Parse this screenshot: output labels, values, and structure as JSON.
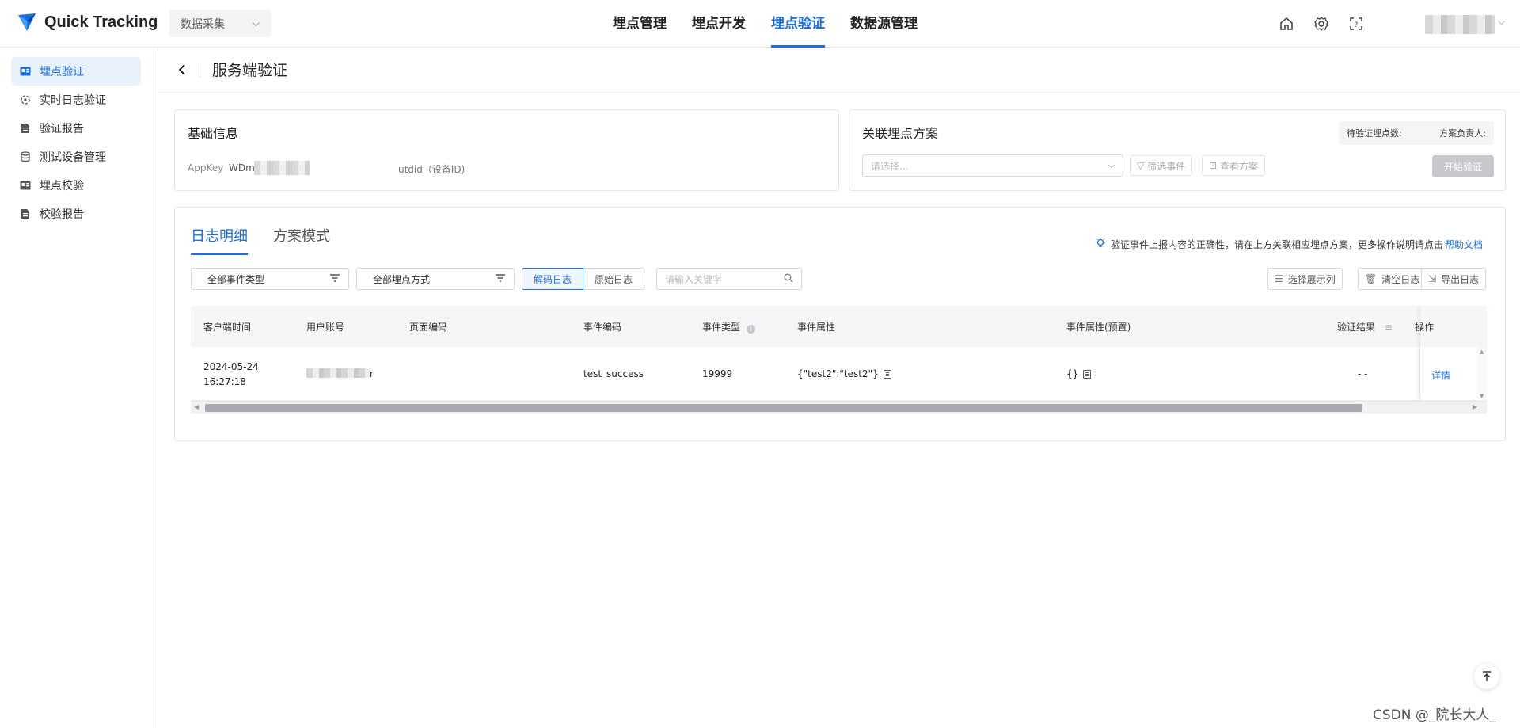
{
  "app": {
    "title": "Quick Tracking",
    "module": "数据采集",
    "brand_color": "#1b6fe0"
  },
  "nav": {
    "items": [
      "埋点管理",
      "埋点开发",
      "埋点验证",
      "数据源管理"
    ],
    "active": "埋点验证"
  },
  "top_icons": [
    "home-icon",
    "gear-icon",
    "scan-icon"
  ],
  "sidebar": {
    "items": [
      {
        "label": "埋点验证",
        "icon": "scan-card-icon",
        "active": true
      },
      {
        "label": "实时日志验证",
        "icon": "realtime-icon",
        "active": false
      },
      {
        "label": "验证报告",
        "icon": "report-icon",
        "active": false
      },
      {
        "label": "测试设备管理",
        "icon": "database-icon",
        "active": false
      },
      {
        "label": "埋点校验",
        "icon": "scan-card-icon",
        "active": false
      },
      {
        "label": "校验报告",
        "icon": "report-icon",
        "active": false
      }
    ]
  },
  "page": {
    "title": "服务端验证"
  },
  "basic_info": {
    "title": "基础信息",
    "appkey_label": "AppKey",
    "appkey_value": "WDmV",
    "utdid_label": "utdid（设备ID)"
  },
  "assoc": {
    "title": "关联埋点方案",
    "pending_label": "待验证埋点数:",
    "owner_label": "方案负责人:",
    "select_placeholder": "请选择...",
    "filter_btn": "筛选事件",
    "view_btn": "查看方案",
    "start_btn": "开始验证"
  },
  "log": {
    "tabs": [
      "日志明细",
      "方案模式"
    ],
    "active_tab": "日志明细",
    "hint": "验证事件上报内容的正确性，请在上方关联相应埋点方案，更多操作说明请点击",
    "help_link": "帮助文档",
    "filter_event_type": "全部事件类型",
    "filter_track_mode": "全部埋点方式",
    "seg_decoded": "解码日志",
    "seg_raw": "原始日志",
    "search_placeholder": "请输入关键字",
    "btn_columns": "选择展示列",
    "btn_clear": "清空日志",
    "btn_export": "导出日志",
    "columns": [
      "客户端时间",
      "用户账号",
      "页面编码",
      "事件编码",
      "事件类型",
      "事件属性",
      "事件属性(预置)",
      "验证结果",
      "操作"
    ],
    "rows": [
      {
        "client_time_date": "2024-05-24",
        "client_time_time": "16:27:18",
        "user_account_tail": "r",
        "page_code": "",
        "event_code": "test_success",
        "event_type": "19999",
        "event_props": "{\"test2\":\"test2\"}",
        "event_props_preset": "{}",
        "result": "- -",
        "action": "详情"
      }
    ]
  },
  "watermark": "CSDN @_院长大人_"
}
